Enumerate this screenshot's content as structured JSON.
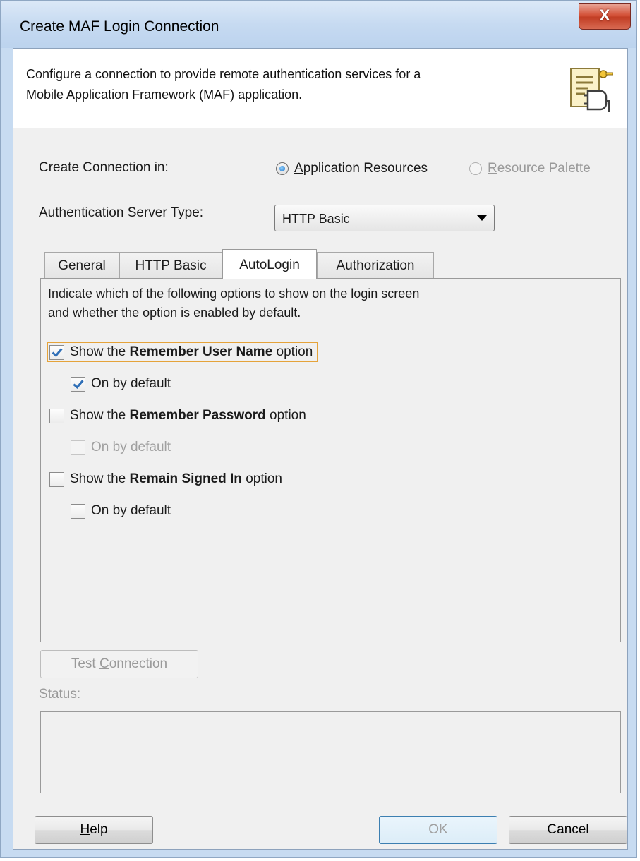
{
  "window": {
    "title": "Create MAF Login Connection",
    "close_label": "X"
  },
  "header": {
    "description_line1": "Configure a connection to provide remote authentication services for a",
    "description_line2": "Mobile Application Framework (MAF) application.",
    "icon": "connection-plug-key-icon"
  },
  "create_connection": {
    "label": "Create Connection in:",
    "options": [
      {
        "mnemonic": "A",
        "rest": "pplication Resources",
        "selected": true,
        "enabled": true
      },
      {
        "mnemonic": "R",
        "rest": "esource Palette",
        "selected": false,
        "enabled": false
      }
    ]
  },
  "auth_server": {
    "label": "Authentication Server Type:",
    "value": "HTTP Basic"
  },
  "tabs": [
    {
      "label": "General",
      "active": false
    },
    {
      "label": "HTTP Basic",
      "active": false
    },
    {
      "label": "AutoLogin",
      "active": true
    },
    {
      "label": "Authorization",
      "active": false
    }
  ],
  "autologin": {
    "description_line1": "Indicate which of the following options to show on the login screen",
    "description_line2": "and whether the option is enabled by default.",
    "options": [
      {
        "prefix": "Show the ",
        "bold": "Remember User Name",
        "suffix": " option",
        "checked": true,
        "default_label": "On by default",
        "default_checked": true,
        "default_enabled": true
      },
      {
        "prefix": "Show the ",
        "bold": "Remember Password",
        "suffix": " option",
        "checked": false,
        "default_label": "On by default",
        "default_checked": false,
        "default_enabled": false
      },
      {
        "prefix": "Show the ",
        "bold": "Remain Signed In",
        "suffix": " option",
        "checked": false,
        "default_label": "On by default",
        "default_checked": false,
        "default_enabled": true
      }
    ]
  },
  "test": {
    "label_before": "Test ",
    "label_mnemonic": "C",
    "label_after": "onnection",
    "status_mnemonic": "S",
    "status_rest": "tatus:"
  },
  "footer": {
    "help_mnemonic": "H",
    "help_rest": "elp",
    "ok_label": "OK",
    "cancel_label": "Cancel"
  }
}
